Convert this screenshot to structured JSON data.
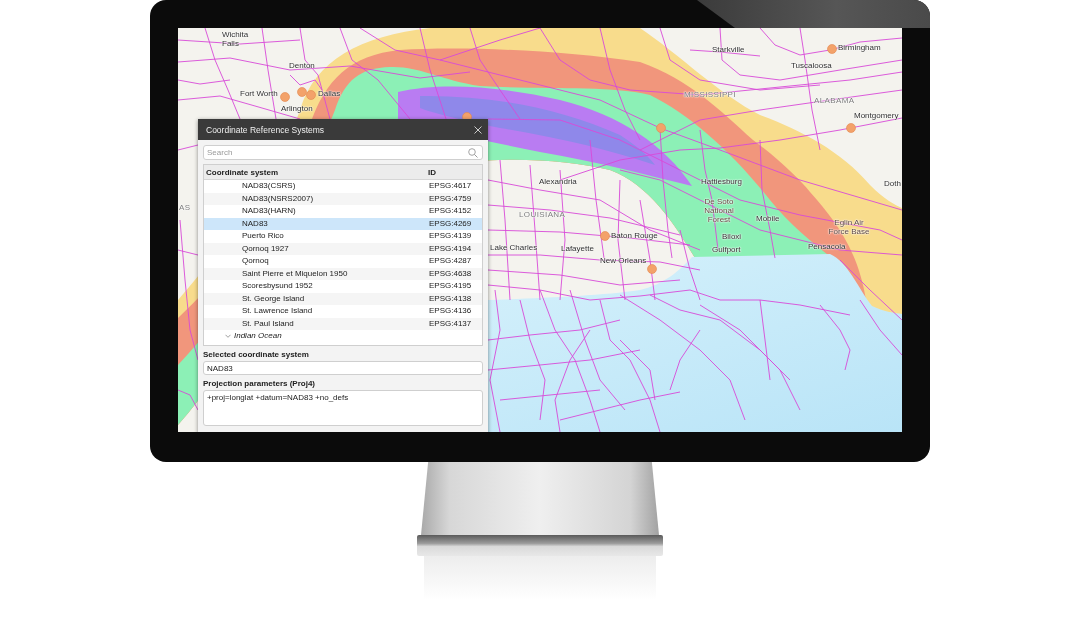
{
  "map": {
    "labels": [
      {
        "kind": "city",
        "text": "Wichita Falls"
      },
      {
        "kind": "city",
        "text": "Denton"
      },
      {
        "kind": "city",
        "text": "Fort Worth"
      },
      {
        "kind": "city",
        "text": "Arlington"
      },
      {
        "kind": "city",
        "text": "Dallas"
      },
      {
        "kind": "city",
        "text": "Starkville"
      },
      {
        "kind": "city",
        "text": "Birmingham"
      },
      {
        "kind": "city",
        "text": "Tuscaloosa"
      },
      {
        "kind": "state",
        "text": "MISSISSIPPI"
      },
      {
        "kind": "state",
        "text": "ALABAMA"
      },
      {
        "kind": "city",
        "text": "Montgomery"
      },
      {
        "kind": "state",
        "text": "AS"
      },
      {
        "kind": "city",
        "text": "Alexandria"
      },
      {
        "kind": "state",
        "text": "LOUISIANA"
      },
      {
        "kind": "city",
        "text": "Lake Charles"
      },
      {
        "kind": "city",
        "text": "Lafayette"
      },
      {
        "kind": "city",
        "text": "Baton Rouge"
      },
      {
        "kind": "city",
        "text": "New Orleans"
      },
      {
        "kind": "city",
        "text": "Hattiesburg"
      },
      {
        "kind": "area",
        "text": "De Soto National Forest"
      },
      {
        "kind": "city",
        "text": "Mobile"
      },
      {
        "kind": "city",
        "text": "Biloxi"
      },
      {
        "kind": "city",
        "text": "Gulfport"
      },
      {
        "kind": "area",
        "text": "Eglin Air Force Base"
      },
      {
        "kind": "city",
        "text": "Pensacola"
      },
      {
        "kind": "city",
        "text": "Doth"
      }
    ]
  },
  "dialog": {
    "title": "Coordinate Reference Systems",
    "search": {
      "placeholder": "Search"
    },
    "table": {
      "columns": [
        "Coordinate system",
        "ID"
      ],
      "rows": [
        {
          "kind": "item",
          "name": "NAD83(CSRS)",
          "id": "EPSG:4617",
          "selected": false
        },
        {
          "kind": "item",
          "name": "NAD83(NSRS2007)",
          "id": "EPSG:4759",
          "selected": false
        },
        {
          "kind": "item",
          "name": "NAD83(HARN)",
          "id": "EPSG:4152",
          "selected": false
        },
        {
          "kind": "item",
          "name": "NAD83",
          "id": "EPSG:4269",
          "selected": true
        },
        {
          "kind": "item",
          "name": "Puerto Rico",
          "id": "EPSG:4139",
          "selected": false
        },
        {
          "kind": "item",
          "name": "Qornoq 1927",
          "id": "EPSG:4194",
          "selected": false
        },
        {
          "kind": "item",
          "name": "Qornoq",
          "id": "EPSG:4287",
          "selected": false
        },
        {
          "kind": "item",
          "name": "Saint Pierre et Miquelon 1950",
          "id": "EPSG:4638",
          "selected": false
        },
        {
          "kind": "item",
          "name": "Scoresbysund 1952",
          "id": "EPSG:4195",
          "selected": false
        },
        {
          "kind": "item",
          "name": "St. George Island",
          "id": "EPSG:4138",
          "selected": false
        },
        {
          "kind": "item",
          "name": "St. Lawrence Island",
          "id": "EPSG:4136",
          "selected": false
        },
        {
          "kind": "item",
          "name": "St. Paul Island",
          "id": "EPSG:4137",
          "selected": false
        },
        {
          "kind": "group",
          "name": "Indian Ocean",
          "expanded": true,
          "selected": false
        }
      ]
    },
    "selected_system": {
      "label": "Selected coordinate system",
      "value": "NAD83"
    },
    "projection": {
      "label": "Projection parameters (Proj4)",
      "value": "+proj=longlat +datum=NAD83 +no_defs"
    }
  }
}
